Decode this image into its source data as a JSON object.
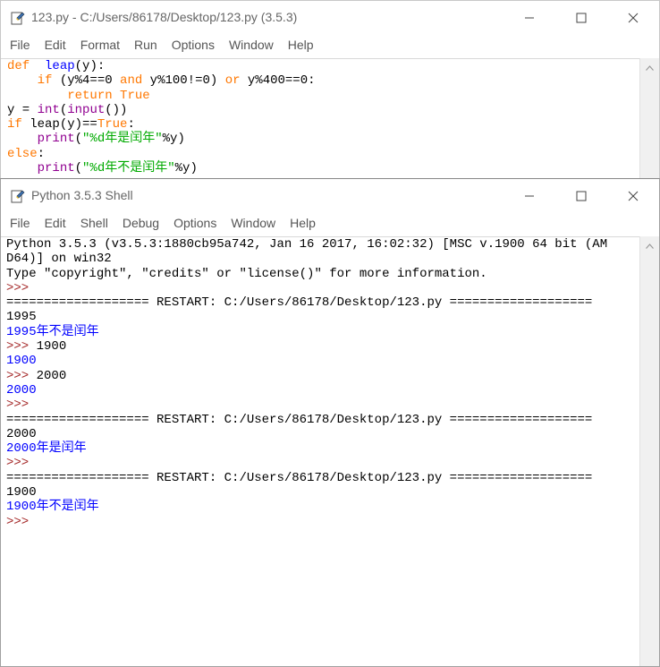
{
  "editor": {
    "title": "123.py - C:/Users/86178/Desktop/123.py (3.5.3)",
    "menu": [
      "File",
      "Edit",
      "Format",
      "Run",
      "Options",
      "Window",
      "Help"
    ],
    "code_lines": [
      [
        {
          "t": "def",
          "c": "kw"
        },
        {
          "t": "  leap",
          "c": "out"
        },
        {
          "t": "(y):",
          "c": ""
        }
      ],
      [
        {
          "t": "    ",
          "c": ""
        },
        {
          "t": "if",
          "c": "kw"
        },
        {
          "t": " (y%4==0 ",
          "c": ""
        },
        {
          "t": "and",
          "c": "kw"
        },
        {
          "t": " y%100!=0) ",
          "c": ""
        },
        {
          "t": "or",
          "c": "kw"
        },
        {
          "t": " y%400==0:",
          "c": ""
        }
      ],
      [
        {
          "t": "        ",
          "c": ""
        },
        {
          "t": "return",
          "c": "kw"
        },
        {
          "t": " ",
          "c": ""
        },
        {
          "t": "True",
          "c": "kw"
        }
      ],
      [
        {
          "t": "y = ",
          "c": ""
        },
        {
          "t": "int",
          "c": "bi"
        },
        {
          "t": "(",
          "c": ""
        },
        {
          "t": "input",
          "c": "bi"
        },
        {
          "t": "())",
          "c": ""
        }
      ],
      [
        {
          "t": "if",
          "c": "kw"
        },
        {
          "t": " leap(y)==",
          "c": ""
        },
        {
          "t": "True",
          "c": "kw"
        },
        {
          "t": ":",
          "c": ""
        }
      ],
      [
        {
          "t": "    ",
          "c": ""
        },
        {
          "t": "print",
          "c": "bi"
        },
        {
          "t": "(",
          "c": ""
        },
        {
          "t": "\"%d年是闰年\"",
          "c": "st"
        },
        {
          "t": "%y)",
          "c": ""
        }
      ],
      [
        {
          "t": "else",
          "c": "kw"
        },
        {
          "t": ":",
          "c": ""
        }
      ],
      [
        {
          "t": "    ",
          "c": ""
        },
        {
          "t": "print",
          "c": "bi"
        },
        {
          "t": "(",
          "c": ""
        },
        {
          "t": "\"%d年不是闰年\"",
          "c": "st"
        },
        {
          "t": "%y)",
          "c": ""
        }
      ]
    ]
  },
  "shell": {
    "title": "Python 3.5.3 Shell",
    "menu": [
      "File",
      "Edit",
      "Shell",
      "Debug",
      "Options",
      "Window",
      "Help"
    ],
    "lines": [
      [
        {
          "t": "Python 3.5.3 (v3.5.3:1880cb95a742, Jan 16 2017, 16:02:32) [MSC v.1900 64 bit (AM",
          "c": ""
        }
      ],
      [
        {
          "t": "D64)] on win32",
          "c": ""
        }
      ],
      [
        {
          "t": "Type \"copyright\", \"credits\" or \"license()\" for more information.",
          "c": ""
        }
      ],
      [
        {
          "t": ">>>",
          "c": "pr"
        }
      ],
      [
        {
          "t": "=================== RESTART: C:/Users/86178/Desktop/123.py ===================",
          "c": ""
        }
      ],
      [
        {
          "t": "1995",
          "c": ""
        }
      ],
      [
        {
          "t": "1995年不是闰年",
          "c": "out"
        }
      ],
      [
        {
          "t": ">>>",
          "c": "pr"
        },
        {
          "t": " 1900",
          "c": ""
        }
      ],
      [
        {
          "t": "1900",
          "c": "out"
        }
      ],
      [
        {
          "t": ">>>",
          "c": "pr"
        },
        {
          "t": " 2000",
          "c": ""
        }
      ],
      [
        {
          "t": "2000",
          "c": "out"
        }
      ],
      [
        {
          "t": ">>>",
          "c": "pr"
        }
      ],
      [
        {
          "t": "=================== RESTART: C:/Users/86178/Desktop/123.py ===================",
          "c": ""
        }
      ],
      [
        {
          "t": "2000",
          "c": ""
        }
      ],
      [
        {
          "t": "2000年是闰年",
          "c": "out"
        }
      ],
      [
        {
          "t": ">>>",
          "c": "pr"
        }
      ],
      [
        {
          "t": "=================== RESTART: C:/Users/86178/Desktop/123.py ===================",
          "c": ""
        }
      ],
      [
        {
          "t": "1900",
          "c": ""
        }
      ],
      [
        {
          "t": "1900年不是闰年",
          "c": "out"
        }
      ],
      [
        {
          "t": ">>>",
          "c": "pr"
        }
      ]
    ]
  },
  "icons": {
    "minimize": "minimize-icon",
    "maximize": "maximize-icon",
    "close": "close-icon",
    "app": "idle-python-icon",
    "scroll_up": "chevron-up-icon"
  },
  "colors": {
    "keyword": "#ff7700",
    "builtin": "#900090",
    "string": "#00aa00",
    "output": "#0000ff",
    "prompt": "#a52a2a"
  }
}
